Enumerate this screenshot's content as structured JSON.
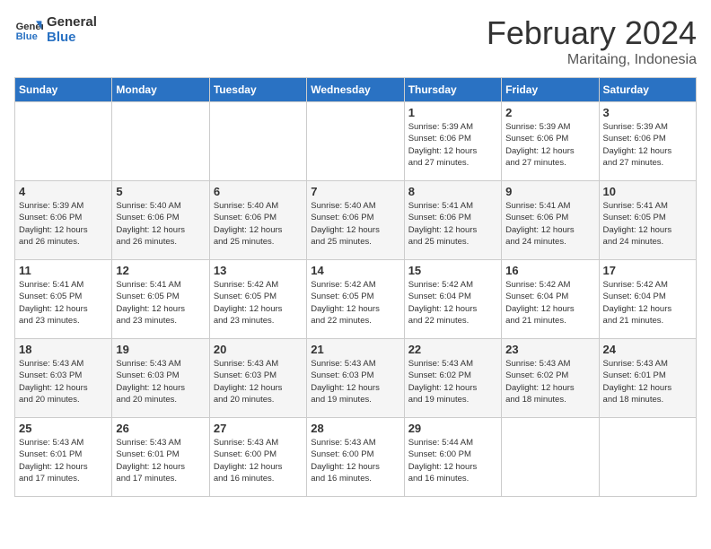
{
  "logo": {
    "line1": "General",
    "line2": "Blue"
  },
  "title": "February 2024",
  "location": "Maritaing, Indonesia",
  "weekdays": [
    "Sunday",
    "Monday",
    "Tuesday",
    "Wednesday",
    "Thursday",
    "Friday",
    "Saturday"
  ],
  "weeks": [
    [
      {
        "day": "",
        "info": ""
      },
      {
        "day": "",
        "info": ""
      },
      {
        "day": "",
        "info": ""
      },
      {
        "day": "",
        "info": ""
      },
      {
        "day": "1",
        "info": "Sunrise: 5:39 AM\nSunset: 6:06 PM\nDaylight: 12 hours\nand 27 minutes."
      },
      {
        "day": "2",
        "info": "Sunrise: 5:39 AM\nSunset: 6:06 PM\nDaylight: 12 hours\nand 27 minutes."
      },
      {
        "day": "3",
        "info": "Sunrise: 5:39 AM\nSunset: 6:06 PM\nDaylight: 12 hours\nand 27 minutes."
      }
    ],
    [
      {
        "day": "4",
        "info": "Sunrise: 5:39 AM\nSunset: 6:06 PM\nDaylight: 12 hours\nand 26 minutes."
      },
      {
        "day": "5",
        "info": "Sunrise: 5:40 AM\nSunset: 6:06 PM\nDaylight: 12 hours\nand 26 minutes."
      },
      {
        "day": "6",
        "info": "Sunrise: 5:40 AM\nSunset: 6:06 PM\nDaylight: 12 hours\nand 25 minutes."
      },
      {
        "day": "7",
        "info": "Sunrise: 5:40 AM\nSunset: 6:06 PM\nDaylight: 12 hours\nand 25 minutes."
      },
      {
        "day": "8",
        "info": "Sunrise: 5:41 AM\nSunset: 6:06 PM\nDaylight: 12 hours\nand 25 minutes."
      },
      {
        "day": "9",
        "info": "Sunrise: 5:41 AM\nSunset: 6:06 PM\nDaylight: 12 hours\nand 24 minutes."
      },
      {
        "day": "10",
        "info": "Sunrise: 5:41 AM\nSunset: 6:05 PM\nDaylight: 12 hours\nand 24 minutes."
      }
    ],
    [
      {
        "day": "11",
        "info": "Sunrise: 5:41 AM\nSunset: 6:05 PM\nDaylight: 12 hours\nand 23 minutes."
      },
      {
        "day": "12",
        "info": "Sunrise: 5:41 AM\nSunset: 6:05 PM\nDaylight: 12 hours\nand 23 minutes."
      },
      {
        "day": "13",
        "info": "Sunrise: 5:42 AM\nSunset: 6:05 PM\nDaylight: 12 hours\nand 23 minutes."
      },
      {
        "day": "14",
        "info": "Sunrise: 5:42 AM\nSunset: 6:05 PM\nDaylight: 12 hours\nand 22 minutes."
      },
      {
        "day": "15",
        "info": "Sunrise: 5:42 AM\nSunset: 6:04 PM\nDaylight: 12 hours\nand 22 minutes."
      },
      {
        "day": "16",
        "info": "Sunrise: 5:42 AM\nSunset: 6:04 PM\nDaylight: 12 hours\nand 21 minutes."
      },
      {
        "day": "17",
        "info": "Sunrise: 5:42 AM\nSunset: 6:04 PM\nDaylight: 12 hours\nand 21 minutes."
      }
    ],
    [
      {
        "day": "18",
        "info": "Sunrise: 5:43 AM\nSunset: 6:03 PM\nDaylight: 12 hours\nand 20 minutes."
      },
      {
        "day": "19",
        "info": "Sunrise: 5:43 AM\nSunset: 6:03 PM\nDaylight: 12 hours\nand 20 minutes."
      },
      {
        "day": "20",
        "info": "Sunrise: 5:43 AM\nSunset: 6:03 PM\nDaylight: 12 hours\nand 20 minutes."
      },
      {
        "day": "21",
        "info": "Sunrise: 5:43 AM\nSunset: 6:03 PM\nDaylight: 12 hours\nand 19 minutes."
      },
      {
        "day": "22",
        "info": "Sunrise: 5:43 AM\nSunset: 6:02 PM\nDaylight: 12 hours\nand 19 minutes."
      },
      {
        "day": "23",
        "info": "Sunrise: 5:43 AM\nSunset: 6:02 PM\nDaylight: 12 hours\nand 18 minutes."
      },
      {
        "day": "24",
        "info": "Sunrise: 5:43 AM\nSunset: 6:01 PM\nDaylight: 12 hours\nand 18 minutes."
      }
    ],
    [
      {
        "day": "25",
        "info": "Sunrise: 5:43 AM\nSunset: 6:01 PM\nDaylight: 12 hours\nand 17 minutes."
      },
      {
        "day": "26",
        "info": "Sunrise: 5:43 AM\nSunset: 6:01 PM\nDaylight: 12 hours\nand 17 minutes."
      },
      {
        "day": "27",
        "info": "Sunrise: 5:43 AM\nSunset: 6:00 PM\nDaylight: 12 hours\nand 16 minutes."
      },
      {
        "day": "28",
        "info": "Sunrise: 5:43 AM\nSunset: 6:00 PM\nDaylight: 12 hours\nand 16 minutes."
      },
      {
        "day": "29",
        "info": "Sunrise: 5:44 AM\nSunset: 6:00 PM\nDaylight: 12 hours\nand 16 minutes."
      },
      {
        "day": "",
        "info": ""
      },
      {
        "day": "",
        "info": ""
      }
    ]
  ]
}
